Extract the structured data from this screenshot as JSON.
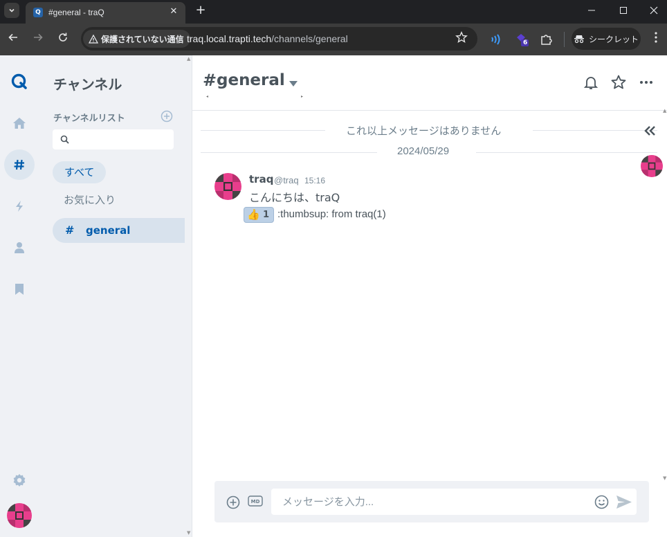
{
  "browser": {
    "tab_title": "#general - traQ",
    "tab_favicon": "Q",
    "security_label": "保護されていない通信",
    "url_host": "traq.local.trapti.tech",
    "url_path": "/channels/general",
    "incognito_label": "シークレット",
    "extension_badge": "6"
  },
  "sidebar": {
    "title": "チャンネル",
    "list_title": "チャンネルリスト",
    "search_placeholder": "",
    "filters": {
      "all": "すべて",
      "favorites": "お気に入り"
    },
    "channels": [
      {
        "hash": "#",
        "name": "general"
      }
    ]
  },
  "channel": {
    "hash": "#",
    "name": "general"
  },
  "timeline": {
    "no_more_label": "これ以上メッセージはありません",
    "date_label": "2024/05/29",
    "messages": [
      {
        "user": "traq",
        "user_id": "@traq",
        "time": "15:16",
        "body": "こんにちは、traQ",
        "stamp_emoji": "👍",
        "stamp_count": "1",
        "stamp_desc": ":thumbsup: from traq(1)"
      }
    ]
  },
  "composer": {
    "placeholder": "メッセージを入力..."
  },
  "colors": {
    "accent": "#005bac",
    "text": "#49535b",
    "sidebar_bg": "#eff1f5",
    "avatar_pink": "#e83e8c"
  }
}
